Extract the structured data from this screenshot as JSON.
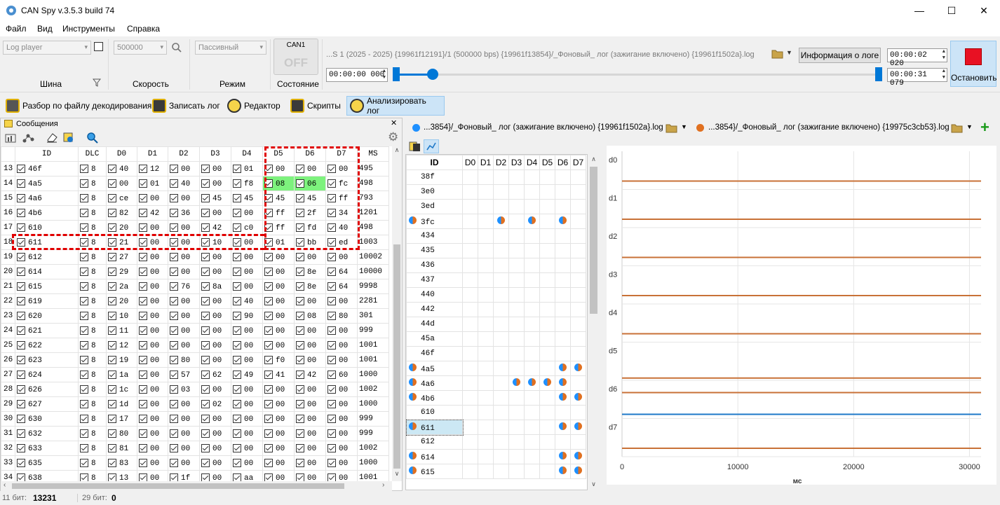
{
  "window": {
    "title": "CAN Spy v.3.5.3 build 74",
    "minimize": "—",
    "maximize": "☐",
    "close": "✕"
  },
  "menu": [
    "Файл",
    "Вид",
    "Инструменты",
    "Справка"
  ],
  "toolbar": {
    "bus_combo": "Log player",
    "bus_label": "Шина",
    "speed_combo": "500000",
    "speed_label": "Скорость",
    "mode_combo": "Пассивный",
    "mode_label": "Режим",
    "channel_name": "CAN1",
    "channel_state": "OFF",
    "state_label": "Состояние",
    "log_path": "...S 1 (2025 - 2025) {19961f12191}/1 (500000 bps) {19961f13854}/_Фоновый_ лог (зажигание включено) {19961f1502a}.log",
    "log_info_button": "Информация о логе",
    "time_start": "00:00:00 000",
    "time_current": "00:00:02 020",
    "time_end": "00:00:31 079",
    "stop_button": "Остановить",
    "slider_progress": 0.02
  },
  "actions": [
    "Разбор по файлу декодирования",
    "Записать лог",
    "Редактор",
    "Скрипты",
    "Анализировать лог"
  ],
  "messages_panel": {
    "title": "Сообщения",
    "columns": [
      "ID",
      "DLC",
      "D0",
      "D1",
      "D2",
      "D3",
      "D4",
      "D5",
      "D6",
      "D7",
      "MS"
    ],
    "rows": [
      [
        "13",
        "46f",
        "8",
        "40",
        "12",
        "00",
        "00",
        "01",
        "00",
        "00",
        "00",
        "495"
      ],
      [
        "14",
        "4a5",
        "8",
        "00",
        "01",
        "40",
        "00",
        "f8",
        "08",
        "06",
        "fc",
        "498"
      ],
      [
        "15",
        "4a6",
        "8",
        "ce",
        "00",
        "00",
        "45",
        "45",
        "45",
        "45",
        "ff",
        "793"
      ],
      [
        "16",
        "4b6",
        "8",
        "82",
        "42",
        "36",
        "00",
        "00",
        "ff",
        "2f",
        "34",
        "1201"
      ],
      [
        "17",
        "610",
        "8",
        "20",
        "00",
        "00",
        "42",
        "c0",
        "ff",
        "fd",
        "40",
        "498"
      ],
      [
        "18",
        "611",
        "8",
        "21",
        "00",
        "00",
        "10",
        "00",
        "01",
        "bb",
        "ed",
        "1003"
      ],
      [
        "19",
        "612",
        "8",
        "27",
        "00",
        "00",
        "00",
        "00",
        "00",
        "00",
        "00",
        "10002"
      ],
      [
        "20",
        "614",
        "8",
        "29",
        "00",
        "00",
        "00",
        "00",
        "00",
        "8e",
        "64",
        "10000"
      ],
      [
        "21",
        "615",
        "8",
        "2a",
        "00",
        "76",
        "8a",
        "00",
        "00",
        "8e",
        "64",
        "9998"
      ],
      [
        "22",
        "619",
        "8",
        "20",
        "00",
        "00",
        "00",
        "40",
        "00",
        "00",
        "00",
        "2281"
      ],
      [
        "23",
        "620",
        "8",
        "10",
        "00",
        "00",
        "00",
        "90",
        "00",
        "08",
        "80",
        "301"
      ],
      [
        "24",
        "621",
        "8",
        "11",
        "00",
        "00",
        "00",
        "00",
        "00",
        "00",
        "00",
        "999"
      ],
      [
        "25",
        "622",
        "8",
        "12",
        "00",
        "00",
        "00",
        "00",
        "00",
        "00",
        "00",
        "1001"
      ],
      [
        "26",
        "623",
        "8",
        "19",
        "00",
        "80",
        "00",
        "00",
        "f0",
        "00",
        "00",
        "1001"
      ],
      [
        "27",
        "624",
        "8",
        "1a",
        "00",
        "57",
        "62",
        "49",
        "41",
        "42",
        "60",
        "1000"
      ],
      [
        "28",
        "626",
        "8",
        "1c",
        "00",
        "03",
        "00",
        "00",
        "00",
        "00",
        "00",
        "1002"
      ],
      [
        "29",
        "627",
        "8",
        "1d",
        "00",
        "00",
        "02",
        "00",
        "00",
        "00",
        "00",
        "1000"
      ],
      [
        "30",
        "630",
        "8",
        "17",
        "00",
        "00",
        "00",
        "00",
        "00",
        "00",
        "00",
        "999"
      ],
      [
        "31",
        "632",
        "8",
        "80",
        "00",
        "00",
        "00",
        "00",
        "00",
        "00",
        "00",
        "999"
      ],
      [
        "32",
        "633",
        "8",
        "81",
        "00",
        "00",
        "00",
        "00",
        "00",
        "00",
        "00",
        "1002"
      ],
      [
        "33",
        "635",
        "8",
        "83",
        "00",
        "00",
        "00",
        "00",
        "00",
        "00",
        "00",
        "1000"
      ],
      [
        "34",
        "638",
        "8",
        "13",
        "00",
        "1f",
        "00",
        "aa",
        "00",
        "00",
        "00",
        "1001"
      ]
    ],
    "highlight_cells": [
      [
        1,
        8
      ],
      [
        1,
        9
      ]
    ]
  },
  "status": {
    "bits11_label": "11 бит:",
    "bits11_value": "13231",
    "bits29_label": "29 бит:",
    "bits29_value": "0"
  },
  "compare": {
    "tab1": "...3854}/_Фоновый_ лог (зажигание включено) {19961f1502a}.log",
    "tab2": "...3854}/_Фоновый_ лог (зажигание включено) {19975c3cb53}.log",
    "tab1_color": "#1e90ff",
    "tab2_color": "#e07020",
    "columns": [
      "ID",
      "D0",
      "D1",
      "D2",
      "D3",
      "D4",
      "D5",
      "D6",
      "D7"
    ],
    "rows": [
      {
        "id": "38f",
        "mark": false,
        "dots": []
      },
      {
        "id": "3e0",
        "mark": false,
        "dots": []
      },
      {
        "id": "3ed",
        "mark": false,
        "dots": []
      },
      {
        "id": "3fc",
        "mark": true,
        "dots": [
          2,
          4,
          6
        ]
      },
      {
        "id": "434",
        "mark": false,
        "dots": []
      },
      {
        "id": "435",
        "mark": false,
        "dots": []
      },
      {
        "id": "436",
        "mark": false,
        "dots": []
      },
      {
        "id": "437",
        "mark": false,
        "dots": []
      },
      {
        "id": "440",
        "mark": false,
        "dots": []
      },
      {
        "id": "442",
        "mark": false,
        "dots": []
      },
      {
        "id": "44d",
        "mark": false,
        "dots": []
      },
      {
        "id": "45a",
        "mark": false,
        "dots": []
      },
      {
        "id": "46f",
        "mark": false,
        "dots": []
      },
      {
        "id": "4a5",
        "mark": true,
        "dots": [
          6,
          7
        ]
      },
      {
        "id": "4a6",
        "mark": true,
        "dots": [
          3,
          4,
          5,
          6
        ]
      },
      {
        "id": "4b6",
        "mark": true,
        "dots": [
          6,
          7
        ]
      },
      {
        "id": "610",
        "mark": false,
        "dots": []
      },
      {
        "id": "611",
        "mark": true,
        "dots": [
          6,
          7
        ]
      },
      {
        "id": "612",
        "mark": false,
        "dots": []
      },
      {
        "id": "614",
        "mark": true,
        "dots": [
          6,
          7
        ]
      },
      {
        "id": "615",
        "mark": true,
        "dots": [
          6,
          7
        ]
      }
    ]
  },
  "chart_data": {
    "type": "line",
    "xlabel": "мс",
    "xlim": [
      0,
      31000
    ],
    "xticks": [
      "0",
      "10000",
      "20000",
      "30000"
    ],
    "rows": [
      "d0",
      "d1",
      "d2",
      "d3",
      "d4",
      "d5",
      "d6",
      "d7"
    ],
    "series": [
      {
        "row": "d0",
        "color": "#c87137",
        "values": [
          [
            0,
            1
          ],
          [
            31000,
            1
          ]
        ]
      },
      {
        "row": "d1",
        "color": "#c87137",
        "values": [
          [
            0,
            1
          ],
          [
            31000,
            1
          ]
        ]
      },
      {
        "row": "d2",
        "color": "#c87137",
        "values": [
          [
            0,
            1
          ],
          [
            31000,
            1
          ]
        ]
      },
      {
        "row": "d3",
        "color": "#c87137",
        "values": [
          [
            0,
            1
          ],
          [
            31000,
            1
          ]
        ]
      },
      {
        "row": "d4",
        "color": "#c87137",
        "values": [
          [
            0,
            1
          ],
          [
            31000,
            1
          ]
        ]
      },
      {
        "row": "d5",
        "color": "#c87137",
        "values": [
          [
            0,
            1
          ],
          [
            31000,
            1
          ]
        ]
      },
      {
        "row": "d6",
        "color": "#c87137",
        "values": [
          [
            0,
            1
          ],
          [
            31000,
            1
          ]
        ]
      },
      {
        "row": "d7",
        "color": "#1e78c8",
        "values": [
          [
            0,
            1
          ],
          [
            31000,
            1
          ]
        ]
      },
      {
        "row": "d7",
        "color": "#c87137",
        "values": [
          [
            0,
            1
          ],
          [
            31000,
            1
          ]
        ]
      }
    ]
  }
}
